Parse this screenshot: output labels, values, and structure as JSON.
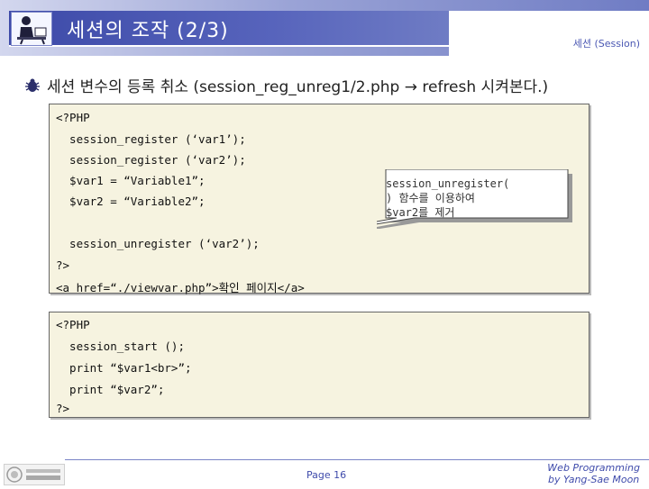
{
  "header": {
    "title": "세션의 조작 (2/3)",
    "subtitle": "세션 (Session)"
  },
  "bullet": {
    "text": "세션 변수의 등록 취소 (session_reg_unreg1/2.php → refresh 시켜본다.)"
  },
  "code_block_1": {
    "lines": [
      "<?PHP",
      "  session_register (‘var1’);",
      "  session_register (‘var2’);",
      "  $var1 = “Variable1”;",
      "  $var2 = “Variable2”;",
      "  session_unregister (‘var2’);",
      "?>",
      "<a href=“./viewvar.php”>확인 페이지</a>"
    ]
  },
  "callout": {
    "lines": [
      "session_unregister(",
      ") 함수를 이용하여",
      "$var2를 제거"
    ]
  },
  "code_block_2": {
    "lines": [
      "<?PHP",
      "  session_start ();",
      "  print “$var1<br>”;",
      "  print “$var2”;",
      "?>"
    ]
  },
  "footer": {
    "page": "Page 16",
    "credit_line1": "Web Programming",
    "credit_line2": "by Yang-Sae Moon"
  },
  "colors": {
    "header_band": "#3d4aa8",
    "accent": "#4b58b3",
    "code_background": "#f6f3e0"
  },
  "icons": {
    "header_logo": "person-at-desk-icon",
    "bullet": "bug-bullet-icon",
    "footer_logo": "university-logo"
  }
}
